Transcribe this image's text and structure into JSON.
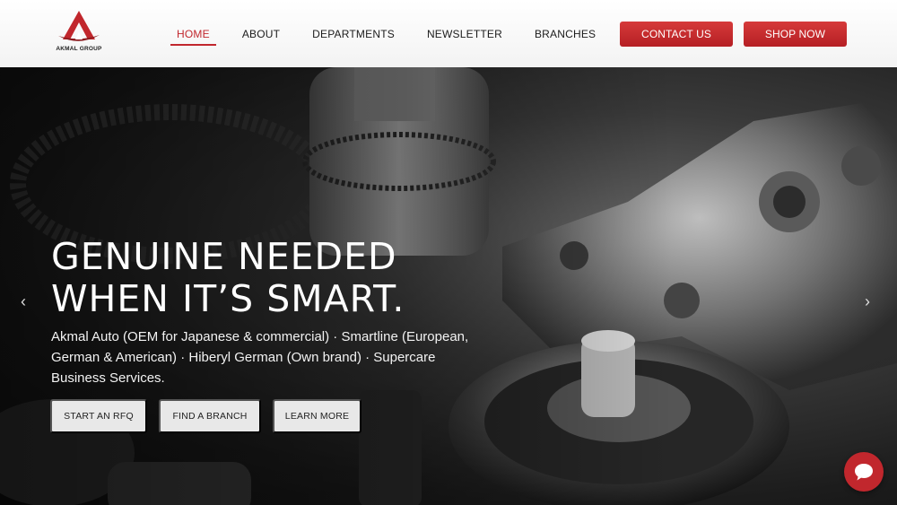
{
  "brand": {
    "name": "AKMAL GROUP"
  },
  "nav": {
    "items": [
      {
        "label": "HOME",
        "active": true
      },
      {
        "label": "ABOUT"
      },
      {
        "label": "DEPARTMENTS"
      },
      {
        "label": "NEWSLETTER"
      },
      {
        "label": "BRANCHES"
      }
    ]
  },
  "header_buttons": {
    "contact": "CONTACT US",
    "shop": "SHOP NOW"
  },
  "hero": {
    "headline_line1": "GENUINE NEEDED",
    "headline_line2": "WHEN IT’S SMART.",
    "subtext": "Akmal Auto (OEM for Japanese & commercial) · Smartline (European, German & American) · Hiberyl German (Own brand) · Supercare Business Services.",
    "buttons": {
      "rfq": "START AN RFQ",
      "branch": "FIND A BRANCH",
      "learn": "LEARN MORE"
    },
    "prev_arrow": "‹",
    "next_arrow": "›"
  },
  "icons": {
    "logo": "akmal-logo-icon",
    "chat": "chat-bubble-icon",
    "prev": "chevron-left-icon",
    "next": "chevron-right-icon"
  },
  "colors": {
    "accent": "#c1272d",
    "header_bg": "#ffffff",
    "button_light": "#e8e8e8"
  }
}
